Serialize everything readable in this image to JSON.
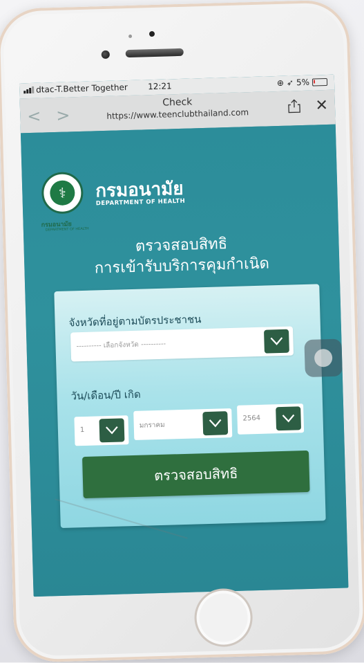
{
  "status_bar": {
    "carrier": "dtac-T.Better Together",
    "time": "12:21",
    "battery": "5%"
  },
  "browser": {
    "title": "Check",
    "url": "https://www.teenclubthailand.com"
  },
  "brand": {
    "name_th": "กรมอนามัย",
    "name_en": "DEPARTMENT OF HEALTH",
    "logo_caption_th": "กรมอนามัย",
    "logo_caption_en": "DEPARTMENT OF HEALTH"
  },
  "heading": {
    "line1": "ตรวจสอบสิทธิ",
    "line2": "การเข้ารับบริการคุมกำเนิด"
  },
  "form": {
    "province_label": "จังหวัดที่อยู่ตามบัตรประชาชน",
    "province_value": "---------- เลือกจังหวัด ----------",
    "birthdate_label": "วัน/เดือน/ปี เกิด",
    "day_value": "1",
    "month_value": "มกราคม",
    "year_value": "2564",
    "submit_label": "ตรวจสอบสิทธิ"
  },
  "colors": {
    "background": "#2b8e9b",
    "card": "#a9e2ea",
    "dropdown_button": "#2d5e44",
    "submit_button": "#2f6f3e"
  }
}
